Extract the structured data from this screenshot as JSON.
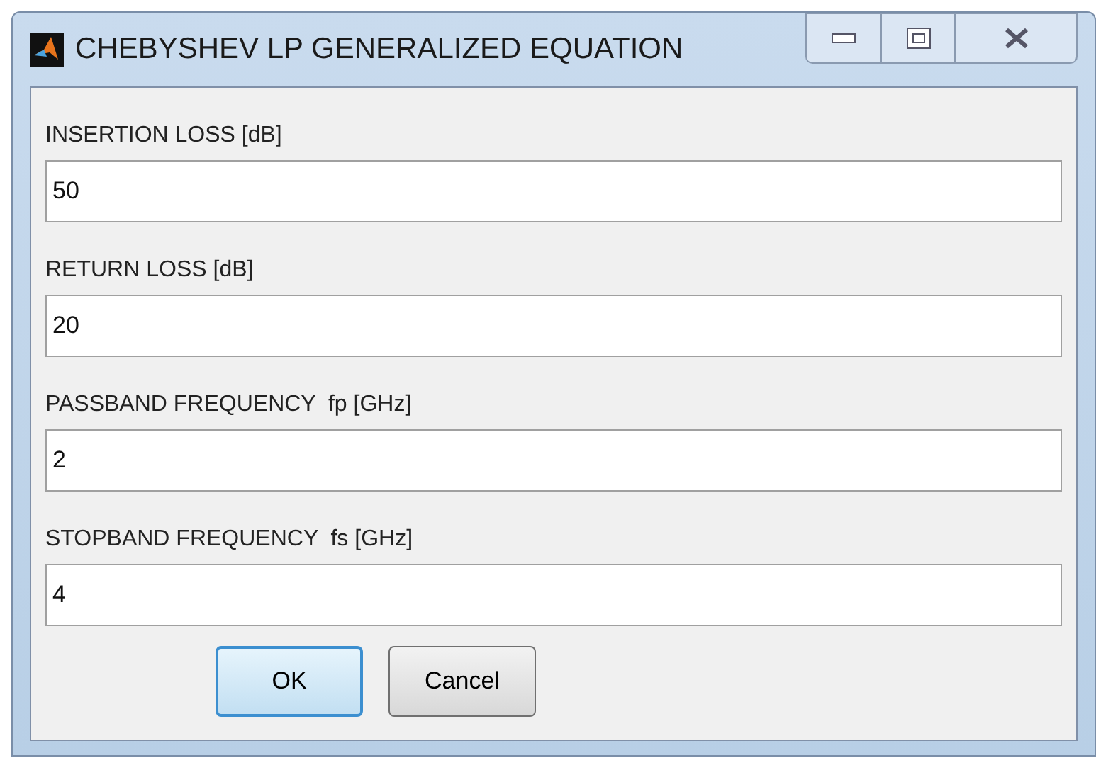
{
  "window": {
    "title": "CHEBYSHEV LP GENERALIZED EQUATION"
  },
  "fields": [
    {
      "label": "INSERTION LOSS [dB]",
      "value": "50"
    },
    {
      "label": "RETURN LOSS [dB]",
      "value": "20"
    },
    {
      "label": "PASSBAND FREQUENCY  fp [GHz]",
      "value": "2"
    },
    {
      "label": "STOPBAND FREQUENCY  fs [GHz]",
      "value": "4"
    }
  ],
  "buttons": [
    {
      "label": "OK",
      "selected": true
    },
    {
      "label": "Cancel",
      "selected": false
    }
  ]
}
